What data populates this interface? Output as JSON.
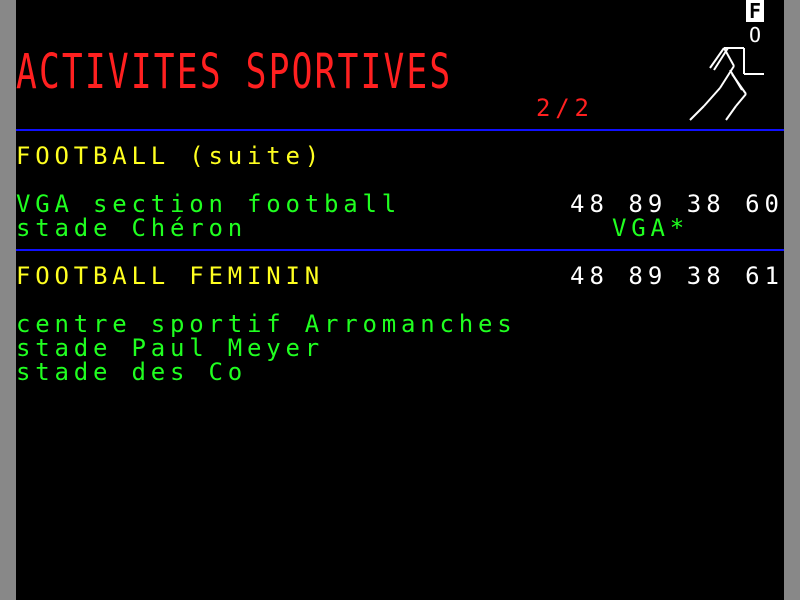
{
  "header": {
    "title": "ACTIVITES SPORTIVES",
    "page_indicator": "2/2",
    "badge_f": "F",
    "badge_o": "O",
    "figure_icon": "runner-icon"
  },
  "section1": {
    "heading": "FOOTBALL (suite)",
    "entry_name": "VGA section football",
    "entry_phone": "48 89 38 60",
    "entry_location": "stade Chéron",
    "entry_code": "VGA*"
  },
  "section2": {
    "heading": "FOOTBALL FEMININ",
    "phone": "48 89 38 61",
    "venues": [
      "centre sportif Arromanches",
      "stade Paul Meyer",
      "stade des Co"
    ]
  },
  "colors": {
    "background": "#000000",
    "title": "#ff2020",
    "heading": "#ffff20",
    "text": "#20ff20",
    "phone": "#ffffff",
    "divider": "#1010ff"
  }
}
